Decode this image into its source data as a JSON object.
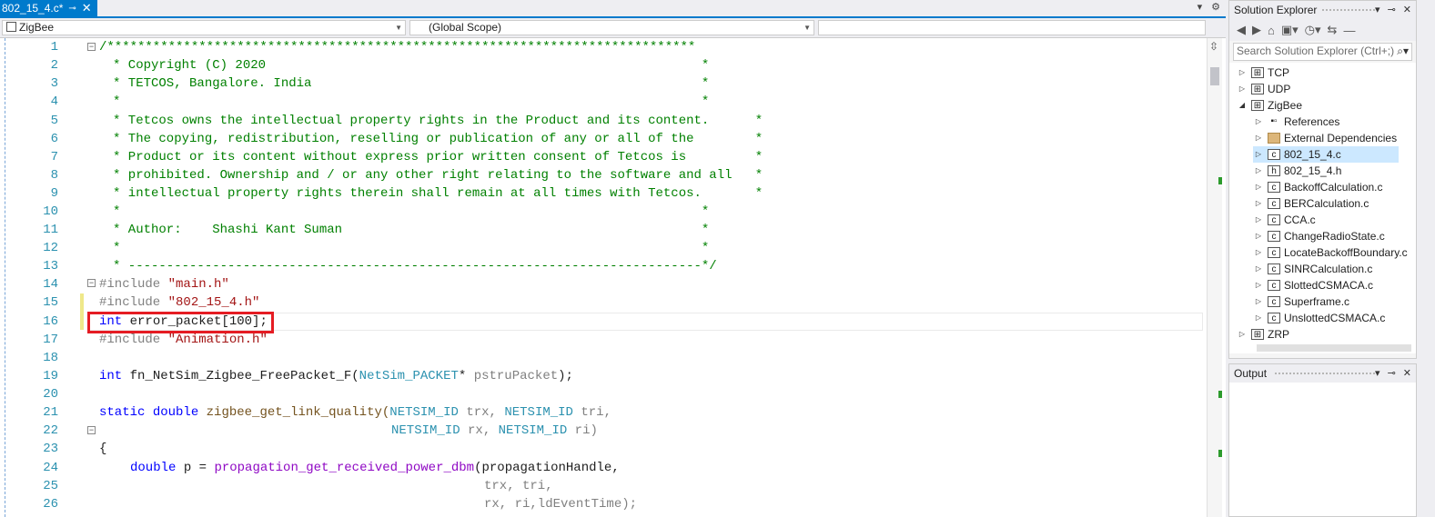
{
  "editor": {
    "tab_title": "802_15_4.c*",
    "tab_pin": "⊸",
    "tab_close": "✕",
    "overflow": "▾",
    "settings": "⚙",
    "project_dropdown": "ZigBee",
    "scope_dropdown": "(Global Scope)",
    "member_dropdown": "",
    "lines": [
      {
        "n": "1"
      },
      {
        "n": "2"
      },
      {
        "n": "3"
      },
      {
        "n": "4"
      },
      {
        "n": "5"
      },
      {
        "n": "6"
      },
      {
        "n": "7"
      },
      {
        "n": "8"
      },
      {
        "n": "9"
      },
      {
        "n": "10"
      },
      {
        "n": "11"
      },
      {
        "n": "12"
      },
      {
        "n": "13"
      },
      {
        "n": "14"
      },
      {
        "n": "15"
      },
      {
        "n": "16"
      },
      {
        "n": "17"
      },
      {
        "n": "18"
      },
      {
        "n": "19"
      },
      {
        "n": "20"
      },
      {
        "n": "21"
      },
      {
        "n": "22"
      },
      {
        "n": "23"
      },
      {
        "n": "24"
      },
      {
        "n": "25"
      },
      {
        "n": "26"
      }
    ],
    "code": {
      "l1": "/*****************************************************************************",
      "l2": "* Copyright (C) 2020                                                         *",
      "l3": "* TETCOS, Bangalore. India                                                   *",
      "l4": "*                                                                            *",
      "l5": "* Tetcos owns the intellectual property rights in the Product and its content.      *",
      "l6": "* The copying, redistribution, reselling or publication of any or all of the        *",
      "l7": "* Product or its content without express prior written consent of Tetcos is         *",
      "l8": "* prohibited. Ownership and / or any other right relating to the software and all   *",
      "l9": "* intellectual property rights therein shall remain at all times with Tetcos.       *",
      "l10": "*                                                                            *",
      "l11": "* Author:    Shashi Kant Suman                                               *",
      "l12": "*                                                                            *",
      "l13": "* ---------------------------------------------------------------------------*/",
      "l14_a": "#include ",
      "l14_b": "\"main.h\"",
      "l15_a": "#include ",
      "l15_b": "\"802_15_4.h\"",
      "l16_a": "int",
      "l16_b": " error_packet[100];",
      "l17_a": "#include ",
      "l17_b": "\"Animation.h\"",
      "l19_a": "int",
      "l19_b": " fn_NetSim_Zigbee_FreePacket_F(",
      "l19_c": "NetSim_PACKET",
      "l19_d": "* ",
      "l19_e": "pstruPacket",
      "l19_f": ");",
      "l21_a": "static",
      "l21_b": " ",
      "l21_c": "double",
      "l21_d": " zigbee_get_link_quality(",
      "l21_e": "NETSIM_ID",
      "l21_f": " trx, ",
      "l21_g": "NETSIM_ID",
      "l21_h": " tri,",
      "l22_a": "NETSIM_ID",
      "l22_b": " rx, ",
      "l22_c": "NETSIM_ID",
      "l22_d": " ri)",
      "l23": "{",
      "l24_a": "double",
      "l24_b": " p = ",
      "l24_c": "propagation_get_received_power_dbm",
      "l24_d": "(propagationHandle,",
      "l25": "trx, tri,",
      "l26": "rx, ri,ldEventTime);"
    }
  },
  "solution_explorer": {
    "title": "Solution Explorer",
    "search_placeholder": "Search Solution Explorer (Ctrl+;)",
    "items": [
      {
        "label": "TCP"
      },
      {
        "label": "UDP"
      },
      {
        "label": "ZigBee"
      },
      {
        "label": "References"
      },
      {
        "label": "External Dependencies"
      },
      {
        "label": "802_15_4.c"
      },
      {
        "label": "802_15_4.h"
      },
      {
        "label": "BackoffCalculation.c"
      },
      {
        "label": "BERCalculation.c"
      },
      {
        "label": "CCA.c"
      },
      {
        "label": "ChangeRadioState.c"
      },
      {
        "label": "LocateBackoffBoundary.c"
      },
      {
        "label": "SINRCalculation.c"
      },
      {
        "label": "SlottedCSMACA.c"
      },
      {
        "label": "Superframe.c"
      },
      {
        "label": "UnslottedCSMACA.c"
      },
      {
        "label": "ZRP"
      }
    ]
  },
  "output": {
    "title": "Output"
  }
}
